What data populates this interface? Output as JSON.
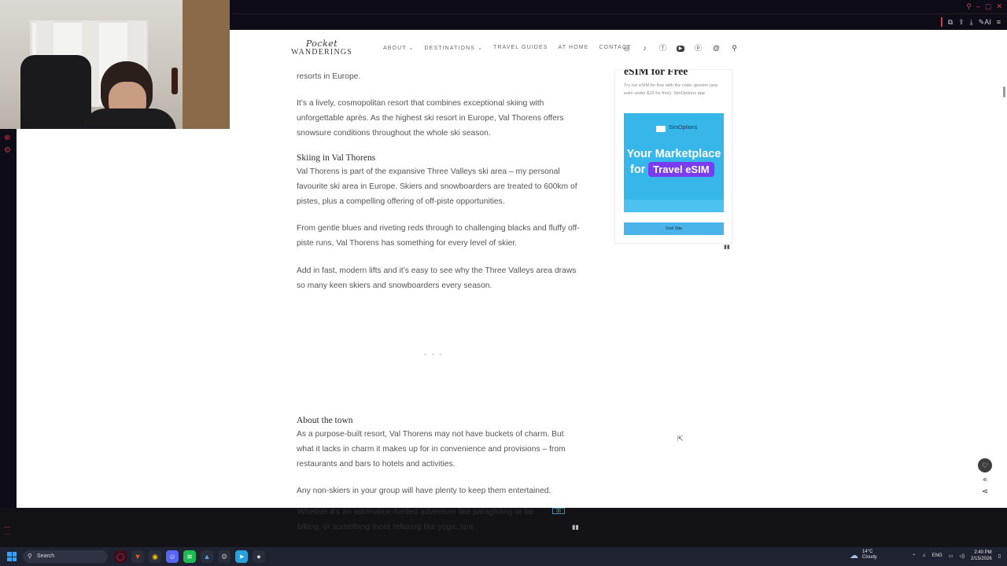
{
  "browser": {
    "window_controls": [
      "search-icon",
      "minimize",
      "maximize",
      "close"
    ],
    "toolbar_icons": [
      "extensions-icon",
      "share-icon",
      "download-icon",
      "leo-icon",
      "menu-icon"
    ],
    "ai_label": "AI"
  },
  "site": {
    "logo_script": "Pocket",
    "logo_caps": "WANDERINGS",
    "nav": [
      {
        "label": "ABOUT",
        "dropdown": true
      },
      {
        "label": "DESTINATIONS",
        "dropdown": true
      },
      {
        "label": "TRAVEL GUIDES",
        "dropdown": false
      },
      {
        "label": "AT HOME",
        "dropdown": false
      },
      {
        "label": "CONTACT",
        "dropdown": false
      }
    ],
    "social_icons": [
      "instagram-icon",
      "tiktok-icon",
      "facebook-icon",
      "youtube-icon",
      "pinterest-icon",
      "threads-icon",
      "search-icon"
    ]
  },
  "article": {
    "p0": "resorts in Europe.",
    "p1": "It’s a lively, cosmopolitan resort that combines exceptional skiing with unforgettable après. As the highest ski resort in Europe, Val Thorens offers snowsure conditions throughout the whole ski season.",
    "h_skiing": "Skiing in Val Thorens",
    "p2": "Val Thorens is part of the expansive Three Valleys ski area – my personal favourite ski area in Europe. Skiers and snowboarders are treated to 600km of pistes, plus a compelling offering of off-piste opportunities.",
    "p3": "From gentle blues and riveting reds through to challenging blacks and fluffy off-piste runs, Val Thorens has something for every level of skier.",
    "p4": "Add in fast, modern lifts and it’s easy to see why the Three Valleys area draws so many keen skiers and snowboarders every season.",
    "ad_placeholder": "• • •",
    "h_town": "About the town",
    "p5": "As a purpose-built resort, Val Thorens may not have buckets of charm. But what it lacks in charm it makes up for in convenience and provisions – from restaurants and bars to hotels and activities.",
    "p6_line1": "Any non-skiers in your group will have plenty to keep them entertained.",
    "p6_line2": "Whether it’s an adrenaline-fuelled adventure like paragliding or fat",
    "p6_line3": "biking, or something more relaxing like yoga, spa"
  },
  "widget": {
    "title": "eSIM for Free",
    "desc": "Try our eSIM for free with the code: goesim (any esim under $10 for free)- SimOptions app",
    "banner_brand": "SimOptions",
    "banner_line1": "Your Marketplace",
    "banner_for": "for",
    "banner_pill": "Travel eSIM",
    "button": "Visit Site"
  },
  "floating": {
    "likes": "45"
  },
  "taskbar": {
    "search_placeholder": "Search",
    "apps": [
      "opera-gx",
      "brave",
      "chrome",
      "discord",
      "spotify",
      "vpn",
      "settings",
      "telegram",
      "obs"
    ],
    "weather_temp": "14°C",
    "weather_desc": "Cloudy",
    "lang": "ENG",
    "time": "2:40 PM",
    "date": "2/15/2026"
  },
  "colors": {
    "page_bg": "#ffffff",
    "chrome_bg": "#0e0c16",
    "accent_red": "#d23a4a",
    "banner_blue": "#37b6ea",
    "pill_purple": "#7a3cf0"
  }
}
